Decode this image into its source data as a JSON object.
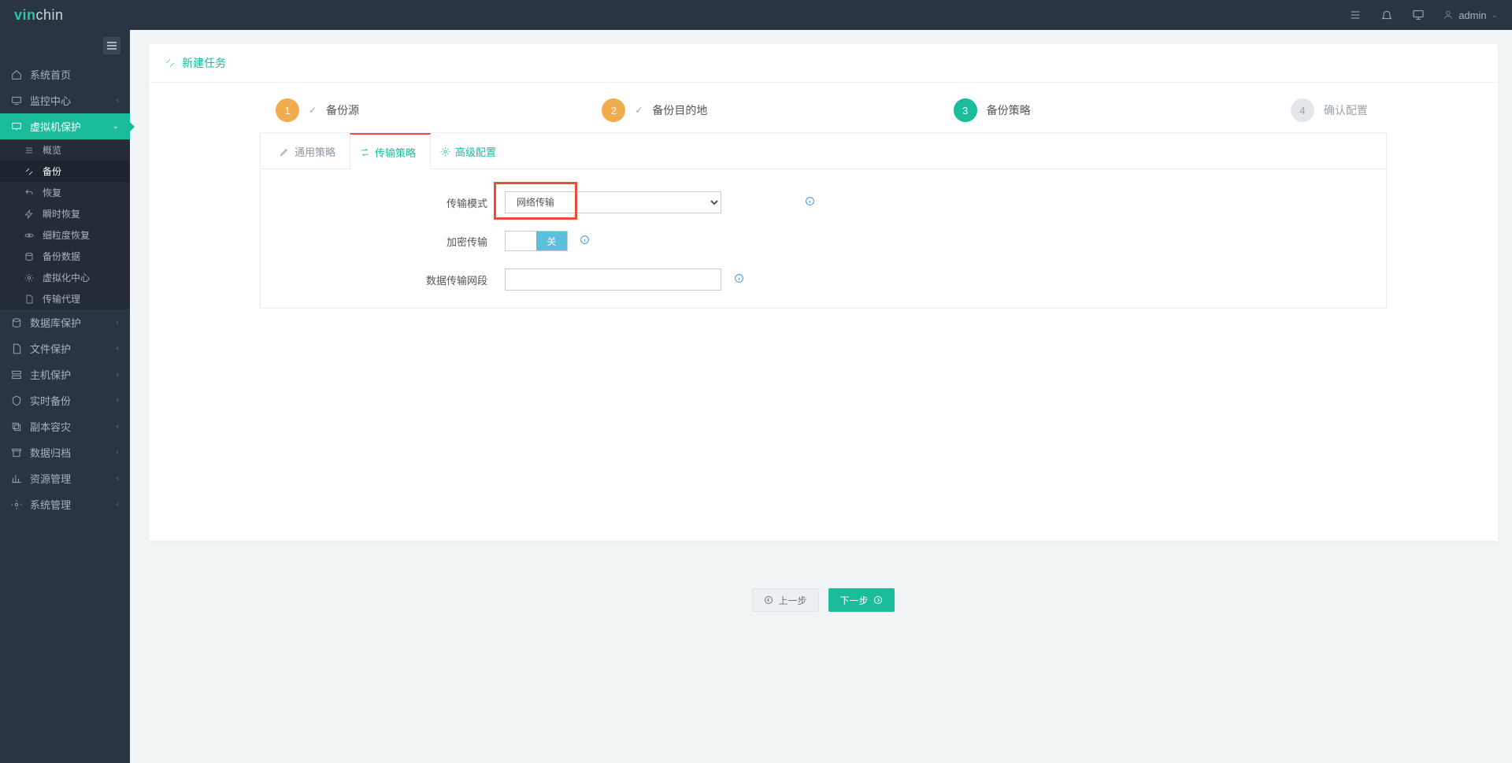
{
  "app": {
    "brand_a": "vin",
    "brand_b": "chin",
    "user": "admin"
  },
  "header": {
    "title": "新建任务"
  },
  "nav": {
    "home": "系统首页",
    "monitor": "监控中心",
    "vm": "虚拟机保护",
    "db": "数据库保护",
    "file": "文件保护",
    "host": "主机保护",
    "realtime": "实时备份",
    "copy": "副本容灾",
    "archive": "数据归档",
    "resource": "资源管理",
    "system": "系统管理",
    "sub": {
      "overview": "概览",
      "backup": "备份",
      "restore": "恢复",
      "instant": "瞬时恢复",
      "granular": "细粒度恢复",
      "data": "备份数据",
      "virt": "虚拟化中心",
      "agent": "传输代理"
    }
  },
  "steps": {
    "s1": {
      "num": "1",
      "label": "备份源"
    },
    "s2": {
      "num": "2",
      "label": "备份目的地"
    },
    "s3": {
      "num": "3",
      "label": "备份策略"
    },
    "s4": {
      "num": "4",
      "label": "确认配置"
    }
  },
  "tabs": {
    "general": "通用策略",
    "transfer": "传输策略",
    "advanced": "高级配置"
  },
  "form": {
    "mode_label": "传输模式",
    "mode_value": "网络传输",
    "encrypt_label": "加密传输",
    "switch_off": "关",
    "segment_label": "数据传输网段",
    "segment_value": ""
  },
  "footer": {
    "prev": "上一步",
    "next": "下一步"
  }
}
